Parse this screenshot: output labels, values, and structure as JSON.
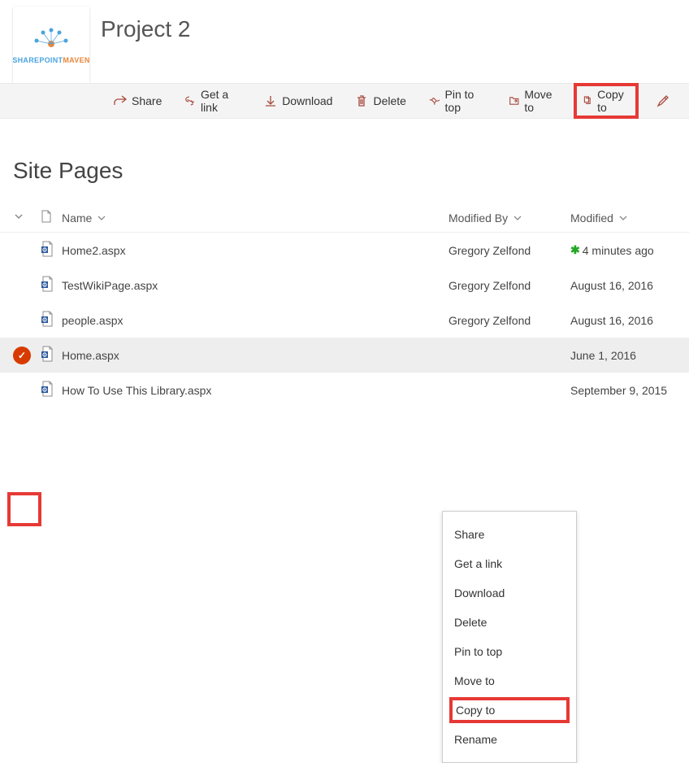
{
  "site": {
    "title": "Project 2"
  },
  "logo": {
    "line1a": "SHAREPOINT",
    "line1b": "MAVEN"
  },
  "toolbar": {
    "share": "Share",
    "get_link": "Get a link",
    "download": "Download",
    "delete": "Delete",
    "pin": "Pin to top",
    "move": "Move to",
    "copy": "Copy to"
  },
  "library": {
    "title": "Site Pages"
  },
  "columns": {
    "name": "Name",
    "modified_by": "Modified By",
    "modified": "Modified"
  },
  "rows": [
    {
      "name": "Home2.aspx",
      "modified_by": "Gregory Zelfond",
      "modified": "4 minutes ago",
      "is_new": true,
      "selected": false
    },
    {
      "name": "TestWikiPage.aspx",
      "modified_by": "Gregory Zelfond",
      "modified": "August 16, 2016",
      "is_new": false,
      "selected": false
    },
    {
      "name": "people.aspx",
      "modified_by": "Gregory Zelfond",
      "modified": "August 16, 2016",
      "is_new": false,
      "selected": false
    },
    {
      "name": "Home.aspx",
      "modified_by": "",
      "modified": "June 1, 2016",
      "is_new": false,
      "selected": true
    },
    {
      "name": "How To Use This Library.aspx",
      "modified_by": "",
      "modified": "September 9, 2015",
      "is_new": false,
      "selected": false
    }
  ],
  "context_menu": [
    "Share",
    "Get a link",
    "Download",
    "Delete",
    "Pin to top",
    "Move to",
    "Copy to",
    "Rename"
  ],
  "ctx_highlight_index": 6
}
